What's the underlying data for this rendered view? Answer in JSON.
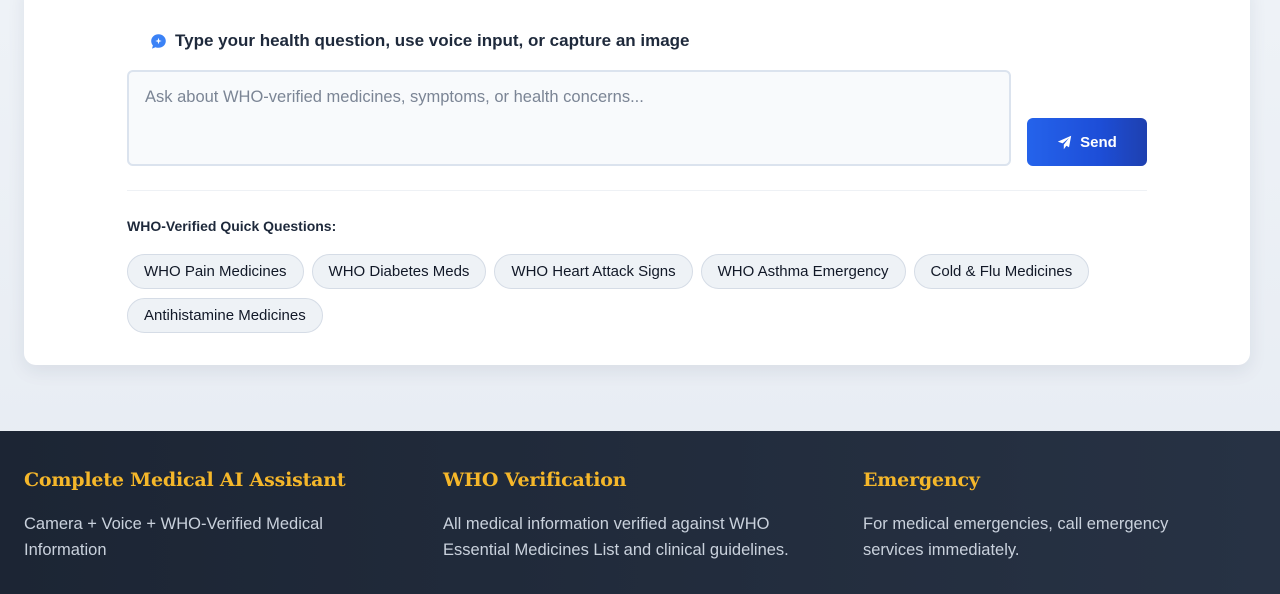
{
  "input_section": {
    "prompt_icon": "chat-bubble-icon",
    "prompt_text": "Type your health question, use voice input, or capture an image",
    "placeholder": "Ask about WHO-verified medicines, symptoms, or health concerns...",
    "value": "",
    "send_icon": "paper-plane-icon",
    "send_label": "Send"
  },
  "quick_questions": {
    "title": "WHO-Verified Quick Questions:",
    "items": [
      "WHO Pain Medicines",
      "WHO Diabetes Meds",
      "WHO Heart Attack Signs",
      "WHO Asthma Emergency",
      "Cold & Flu Medicines",
      "Antihistamine Medicines"
    ]
  },
  "footer": {
    "columns": [
      {
        "title": "Complete Medical AI Assistant",
        "text": "Camera + Voice + WHO-Verified Medical Information"
      },
      {
        "title": "WHO Verification",
        "text": "All medical information verified against WHO Essential Medicines List and clinical guidelines."
      },
      {
        "title": "Emergency",
        "text": "For medical emergencies, call emergency services immediately."
      }
    ]
  },
  "colors": {
    "accent_blue": "#2563eb",
    "footer_heading": "#f5b72a",
    "footer_bg": "#1c2534"
  }
}
